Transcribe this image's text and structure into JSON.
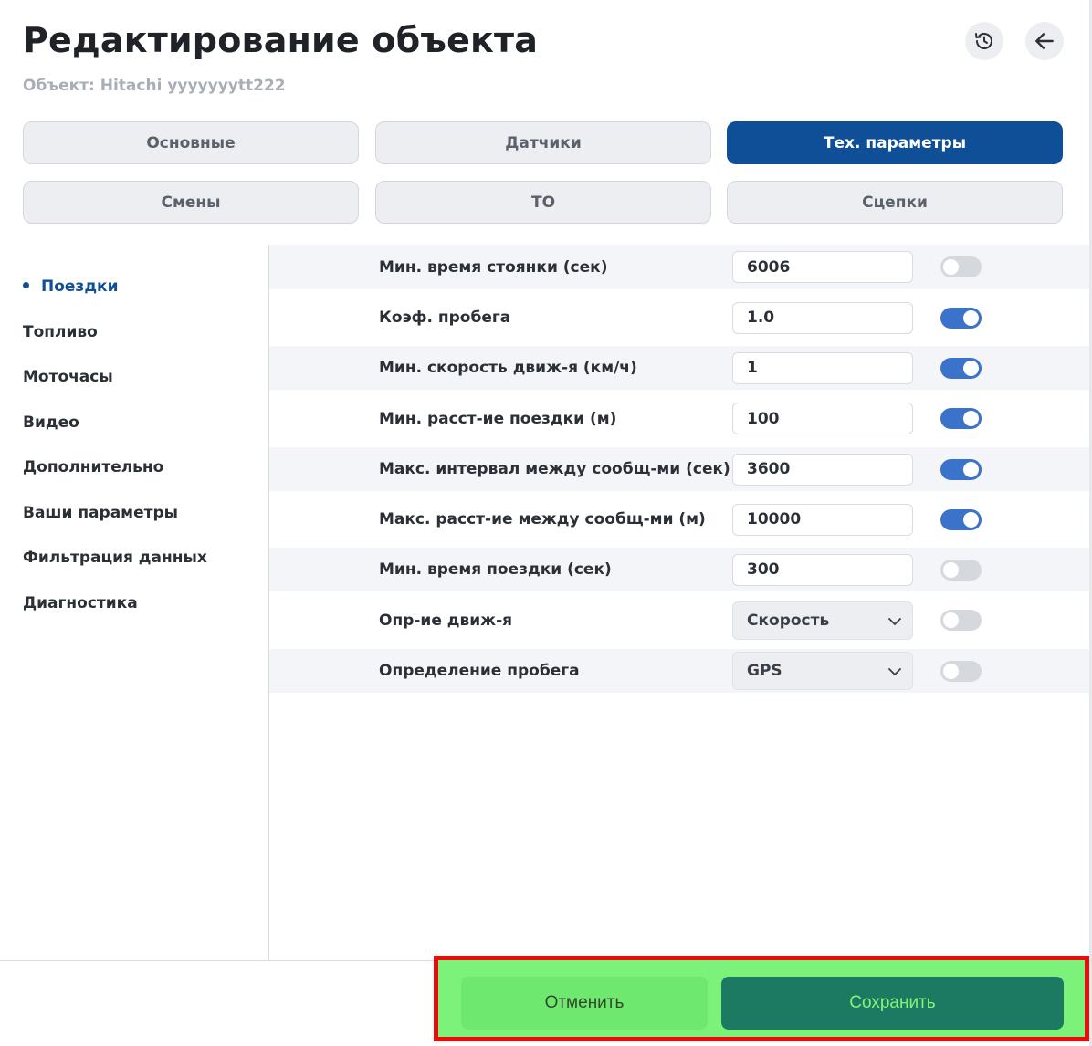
{
  "header": {
    "title": "Редактирование объекта",
    "subtitle": "Объект: Hitachi yyyyyyytt222",
    "history_icon": "history-icon",
    "back_icon": "arrow-left-icon"
  },
  "tabs": [
    {
      "label": "Основные",
      "active": false
    },
    {
      "label": "Датчики",
      "active": false
    },
    {
      "label": "Тех. параметры",
      "active": true
    },
    {
      "label": "Смены",
      "active": false
    },
    {
      "label": "ТО",
      "active": false
    },
    {
      "label": "Сцепки",
      "active": false
    }
  ],
  "sidebar": {
    "items": [
      {
        "label": "Поездки",
        "active": true
      },
      {
        "label": "Топливо",
        "active": false
      },
      {
        "label": "Моточасы",
        "active": false
      },
      {
        "label": "Видео",
        "active": false
      },
      {
        "label": "Дополнительно",
        "active": false
      },
      {
        "label": "Ваши параметры",
        "active": false
      },
      {
        "label": "Фильтрация данных",
        "active": false
      },
      {
        "label": "Диагностика",
        "active": false
      }
    ]
  },
  "params": [
    {
      "label": "Мин. время стоянки (сек)",
      "type": "input",
      "value": "6006",
      "enabled": false
    },
    {
      "label": "Коэф. пробега",
      "type": "input",
      "value": "1.0",
      "enabled": true
    },
    {
      "label": "Мин. скорость движ-я (км/ч)",
      "type": "input",
      "value": "1",
      "enabled": true
    },
    {
      "label": "Мин. расст-ие поездки (м)",
      "type": "input",
      "value": "100",
      "enabled": true
    },
    {
      "label": "Макс. интервал между сообщ-ми (сек)",
      "type": "input",
      "value": "3600",
      "enabled": true
    },
    {
      "label": "Макс. расст-ие между сообщ-ми (м)",
      "type": "input",
      "value": "10000",
      "enabled": true
    },
    {
      "label": "Мин. время поездки (сек)",
      "type": "input",
      "value": "300",
      "enabled": false
    },
    {
      "label": "Опр-ие движ-я",
      "type": "select",
      "value": "Скорость",
      "enabled": false
    },
    {
      "label": "Определение пробега",
      "type": "select",
      "value": "GPS",
      "enabled": false
    }
  ],
  "footer": {
    "cancel_label": "Отменить",
    "save_label": "Сохранить"
  },
  "colors": {
    "primary": "#0f4f98",
    "toggle_on": "#3a73c9",
    "save_bg": "#1d7a62",
    "highlight_bg": "#7df27a",
    "highlight_border": "#ee0a0a"
  }
}
